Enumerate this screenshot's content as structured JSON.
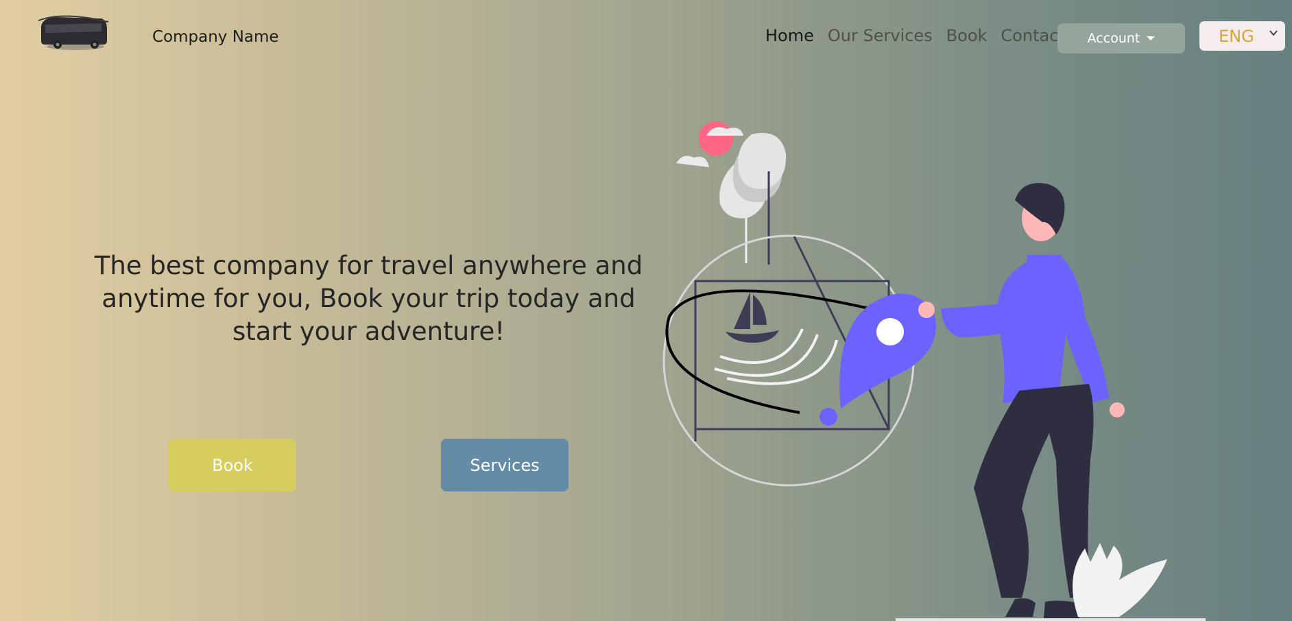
{
  "header": {
    "brand_name": "Company Name",
    "logo_icon": "bus-icon",
    "nav": [
      {
        "label": "Home",
        "active": true
      },
      {
        "label": "Our Services",
        "active": false
      },
      {
        "label": "Book",
        "active": false
      },
      {
        "label": "Contact",
        "active": false
      }
    ],
    "account_label": "Account",
    "language": {
      "selected": "ENG"
    }
  },
  "hero": {
    "headline": "The best company for travel anywhere and anytime for you, Book your trip today and start your adventure!",
    "buttons": {
      "book_label": "Book",
      "services_label": "Services"
    },
    "illustration_icon": "travel-map-illustration"
  },
  "colors": {
    "book_button": "#d5cd5e",
    "services_button": "#658ca6",
    "account_button": "#96a59c",
    "language_text": "#d4a534",
    "accent_purple": "#6c63ff"
  }
}
